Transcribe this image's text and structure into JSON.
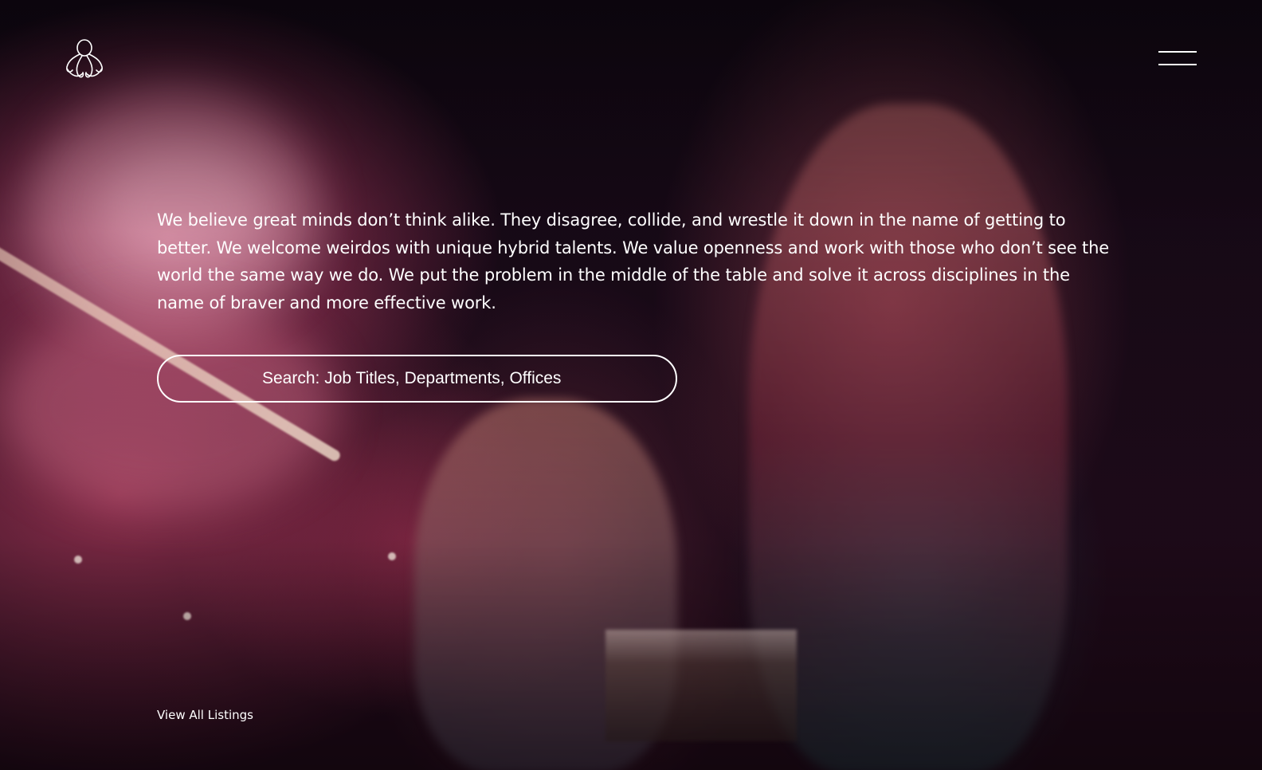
{
  "header": {
    "logo_icon": "octopus-logo-icon",
    "menu_icon": "hamburger-menu-icon"
  },
  "intro": {
    "text": "We believe great minds don’t think alike. They disagree, collide, and wrestle it down in the name of getting to better. We welcome weirdos with unique hybrid talents. We value openness and work with those who don’t see the world the same way we do. We put the problem in the middle of the table and solve it across disciplines in the name of braver and more effective work."
  },
  "search": {
    "placeholder": "Search: Job Titles, Departments, Offices",
    "value": ""
  },
  "listings": {
    "view_all_label": "View All Listings"
  },
  "colors": {
    "text": "#ffffff",
    "background": "#120814",
    "accent": "#d6789a"
  }
}
